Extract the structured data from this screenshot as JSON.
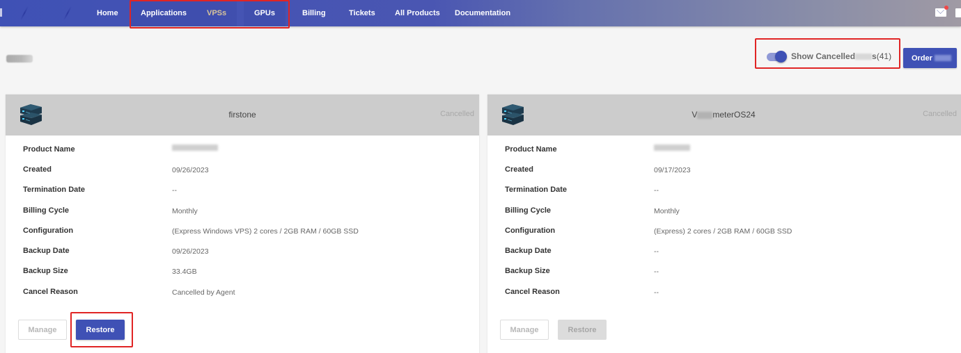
{
  "nav": {
    "items": [
      {
        "label": "Home"
      },
      {
        "label": "Applications"
      },
      {
        "label": "VPSs"
      },
      {
        "label": "GPUs"
      },
      {
        "label": "Billing"
      },
      {
        "label": "Tickets"
      },
      {
        "label": "All Products"
      },
      {
        "label": "Documentation"
      }
    ],
    "active": "VPSs",
    "icons": [
      "mail-icon",
      "user-icon"
    ]
  },
  "toolbar": {
    "toggle_label": "Show Cancelled",
    "toggle_suffix": "s",
    "toggle_count": "(41)",
    "toggle_on": true,
    "order_label": "Order"
  },
  "colors": {
    "primary": "#3f51b5",
    "highlight_outline": "#e02424",
    "card_header": "#cccccc"
  },
  "cards": [
    {
      "title": "firstone",
      "status": "Cancelled",
      "rows": [
        {
          "label": "Product Name",
          "value": ""
        },
        {
          "label": "Created",
          "value": "09/26/2023"
        },
        {
          "label": "Termination Date",
          "value": "--"
        },
        {
          "label": "Billing Cycle",
          "value": "Monthly"
        },
        {
          "label": "Configuration",
          "value": "(Express Windows VPS) 2 cores / 2GB RAM / 60GB SSD"
        },
        {
          "label": "Backup Date",
          "value": "09/26/2023"
        },
        {
          "label": "Backup Size",
          "value": "33.4GB"
        },
        {
          "label": "Cancel Reason",
          "value": "Cancelled by Agent"
        }
      ],
      "manage_label": "Manage",
      "restore_label": "Restore",
      "restore_enabled": true
    },
    {
      "title_prefix": "V",
      "title_suffix": "meterOS24",
      "status": "Cancelled",
      "rows": [
        {
          "label": "Product Name",
          "value": ""
        },
        {
          "label": "Created",
          "value": "09/17/2023"
        },
        {
          "label": "Termination Date",
          "value": "--"
        },
        {
          "label": "Billing Cycle",
          "value": "Monthly"
        },
        {
          "label": "Configuration",
          "value": "(Express) 2 cores / 2GB RAM / 60GB SSD"
        },
        {
          "label": "Backup Date",
          "value": "--"
        },
        {
          "label": "Backup Size",
          "value": "--"
        },
        {
          "label": "Cancel Reason",
          "value": "--"
        }
      ],
      "manage_label": "Manage",
      "restore_label": "Restore",
      "restore_enabled": false
    }
  ]
}
